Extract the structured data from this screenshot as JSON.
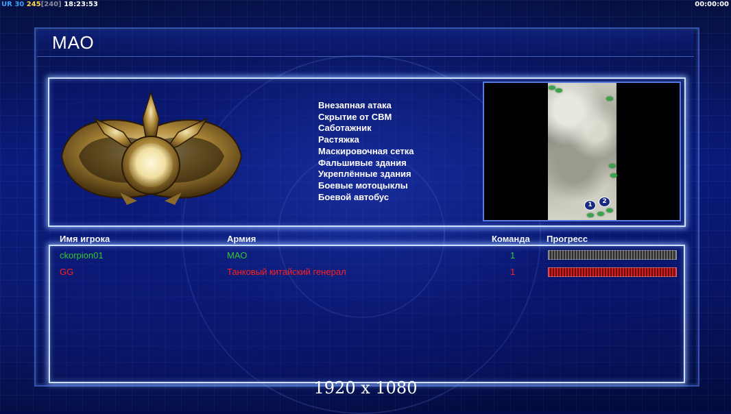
{
  "status_bar": {
    "ur_label": "UR",
    "ur_value": "30",
    "fps": "245",
    "fps_cap": "[240]",
    "clock": "18:23:53",
    "timer": "00:00:00"
  },
  "title": "МАО",
  "features": [
    "Внезапная атака",
    "Скрытие от СВМ",
    "Саботажник",
    "Растяжка",
    "Маскировочная сетка",
    "Фальшивые здания",
    "Укреплённые здания",
    "Боевые мотоцыклы",
    "Боевой автобус"
  ],
  "minimap": {
    "start_positions": [
      "1",
      "2"
    ]
  },
  "table": {
    "headers": {
      "player": "Имя игрока",
      "army": "Армия",
      "team": "Команда",
      "progress": "Прогресс"
    },
    "rows": [
      {
        "player": "ckorpion01",
        "army": "МАО",
        "team": "1",
        "color": "#32c832",
        "progress_fill": 1.0,
        "bar": "grey"
      },
      {
        "player": "GG",
        "army": "Танковый китайский генерал",
        "team": "1",
        "color": "#ff2020",
        "progress_fill": 1.0,
        "bar": "red"
      }
    ]
  },
  "resolution_text": "1920 x 1080",
  "colors": {
    "panel_glow": "#cfe0ff",
    "background": "#0a1a7a",
    "status_ur": "#3fa0ff",
    "status_fps": "#ffd84a"
  }
}
